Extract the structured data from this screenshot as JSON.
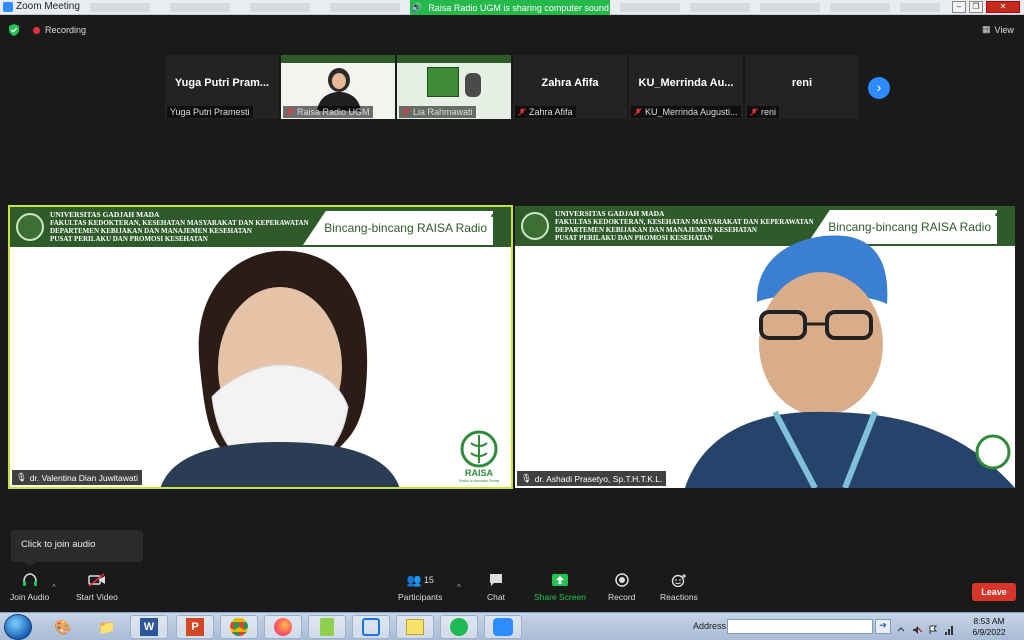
{
  "window": {
    "title": "Zoom Meeting",
    "share_banner": "Raisa Radio UGM is sharing computer sound"
  },
  "meeting": {
    "recording_label": "Recording",
    "view_label": "View"
  },
  "thumbnails": [
    {
      "big_name": "Yuga Putri Pram...",
      "label": "Yuga Putri Pramesti",
      "muted": false,
      "has_video": false
    },
    {
      "big_name": "",
      "label": "Raisa Radio UGM",
      "muted": true,
      "has_video": true
    },
    {
      "big_name": "",
      "label": "Lia Rahmawati",
      "muted": true,
      "has_video": true
    },
    {
      "big_name": "Zahra Afifa",
      "label": "Zahra Afifa",
      "muted": true,
      "has_video": false
    },
    {
      "big_name": "KU_Merrinda  Au...",
      "label": "KU_Merrinda Augusti...",
      "muted": true,
      "has_video": false
    },
    {
      "big_name": "reni",
      "label": "reni",
      "muted": true,
      "has_video": false
    }
  ],
  "banner": {
    "line1": "UNIVERSITAS GADJAH MADA",
    "line2": "FAKULTAS KEDOKTERAN, KESEHATAN MASYARAKAT DAN KEPERAWATAN",
    "line3": "DEPARTEMEN KEBIJAKAN DAN MANAJEMEN KESEHATAN",
    "line4": "PUSAT PERILAKU DAN PROMOSI KESEHATAN",
    "show_name": "Bincang-bincang RAISA Radio",
    "logo_text": "RAISA",
    "logo_sub": "Radio Indonesia Sehat"
  },
  "tiles": {
    "left_name": "dr. Valentina Dian Juwitawati",
    "right_name": "dr. Ashadi Prasetyo, Sp.T.H.T.K.L."
  },
  "tooltip": "Click to join audio",
  "controls": {
    "join_audio": "Join Audio",
    "start_video": "Start Video",
    "participants": "Participants",
    "participants_count": "15",
    "chat": "Chat",
    "share_screen": "Share Screen",
    "record": "Record",
    "reactions": "Reactions",
    "leave": "Leave"
  },
  "taskbar": {
    "address_label": "Address",
    "time": "8:53 AM",
    "date": "6/9/2022"
  },
  "colors": {
    "zoom_blue": "#2d8cff",
    "share_green": "#25b84b",
    "leave_red": "#d8352a",
    "banner_green": "#2f5a2a",
    "active_speaker": "#c7e33a"
  }
}
